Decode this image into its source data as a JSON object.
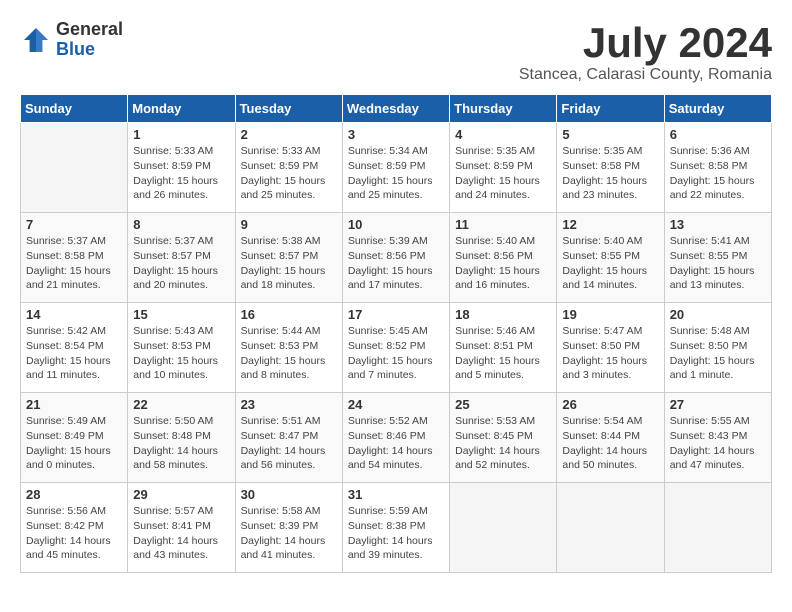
{
  "logo": {
    "general": "General",
    "blue": "Blue"
  },
  "title": {
    "month_year": "July 2024",
    "location": "Stancea, Calarasi County, Romania"
  },
  "weekdays": [
    "Sunday",
    "Monday",
    "Tuesday",
    "Wednesday",
    "Thursday",
    "Friday",
    "Saturday"
  ],
  "weeks": [
    [
      {
        "day": "",
        "info": ""
      },
      {
        "day": "1",
        "info": "Sunrise: 5:33 AM\nSunset: 8:59 PM\nDaylight: 15 hours\nand 26 minutes."
      },
      {
        "day": "2",
        "info": "Sunrise: 5:33 AM\nSunset: 8:59 PM\nDaylight: 15 hours\nand 25 minutes."
      },
      {
        "day": "3",
        "info": "Sunrise: 5:34 AM\nSunset: 8:59 PM\nDaylight: 15 hours\nand 25 minutes."
      },
      {
        "day": "4",
        "info": "Sunrise: 5:35 AM\nSunset: 8:59 PM\nDaylight: 15 hours\nand 24 minutes."
      },
      {
        "day": "5",
        "info": "Sunrise: 5:35 AM\nSunset: 8:58 PM\nDaylight: 15 hours\nand 23 minutes."
      },
      {
        "day": "6",
        "info": "Sunrise: 5:36 AM\nSunset: 8:58 PM\nDaylight: 15 hours\nand 22 minutes."
      }
    ],
    [
      {
        "day": "7",
        "info": "Sunrise: 5:37 AM\nSunset: 8:58 PM\nDaylight: 15 hours\nand 21 minutes."
      },
      {
        "day": "8",
        "info": "Sunrise: 5:37 AM\nSunset: 8:57 PM\nDaylight: 15 hours\nand 20 minutes."
      },
      {
        "day": "9",
        "info": "Sunrise: 5:38 AM\nSunset: 8:57 PM\nDaylight: 15 hours\nand 18 minutes."
      },
      {
        "day": "10",
        "info": "Sunrise: 5:39 AM\nSunset: 8:56 PM\nDaylight: 15 hours\nand 17 minutes."
      },
      {
        "day": "11",
        "info": "Sunrise: 5:40 AM\nSunset: 8:56 PM\nDaylight: 15 hours\nand 16 minutes."
      },
      {
        "day": "12",
        "info": "Sunrise: 5:40 AM\nSunset: 8:55 PM\nDaylight: 15 hours\nand 14 minutes."
      },
      {
        "day": "13",
        "info": "Sunrise: 5:41 AM\nSunset: 8:55 PM\nDaylight: 15 hours\nand 13 minutes."
      }
    ],
    [
      {
        "day": "14",
        "info": "Sunrise: 5:42 AM\nSunset: 8:54 PM\nDaylight: 15 hours\nand 11 minutes."
      },
      {
        "day": "15",
        "info": "Sunrise: 5:43 AM\nSunset: 8:53 PM\nDaylight: 15 hours\nand 10 minutes."
      },
      {
        "day": "16",
        "info": "Sunrise: 5:44 AM\nSunset: 8:53 PM\nDaylight: 15 hours\nand 8 minutes."
      },
      {
        "day": "17",
        "info": "Sunrise: 5:45 AM\nSunset: 8:52 PM\nDaylight: 15 hours\nand 7 minutes."
      },
      {
        "day": "18",
        "info": "Sunrise: 5:46 AM\nSunset: 8:51 PM\nDaylight: 15 hours\nand 5 minutes."
      },
      {
        "day": "19",
        "info": "Sunrise: 5:47 AM\nSunset: 8:50 PM\nDaylight: 15 hours\nand 3 minutes."
      },
      {
        "day": "20",
        "info": "Sunrise: 5:48 AM\nSunset: 8:50 PM\nDaylight: 15 hours\nand 1 minute."
      }
    ],
    [
      {
        "day": "21",
        "info": "Sunrise: 5:49 AM\nSunset: 8:49 PM\nDaylight: 15 hours\nand 0 minutes."
      },
      {
        "day": "22",
        "info": "Sunrise: 5:50 AM\nSunset: 8:48 PM\nDaylight: 14 hours\nand 58 minutes."
      },
      {
        "day": "23",
        "info": "Sunrise: 5:51 AM\nSunset: 8:47 PM\nDaylight: 14 hours\nand 56 minutes."
      },
      {
        "day": "24",
        "info": "Sunrise: 5:52 AM\nSunset: 8:46 PM\nDaylight: 14 hours\nand 54 minutes."
      },
      {
        "day": "25",
        "info": "Sunrise: 5:53 AM\nSunset: 8:45 PM\nDaylight: 14 hours\nand 52 minutes."
      },
      {
        "day": "26",
        "info": "Sunrise: 5:54 AM\nSunset: 8:44 PM\nDaylight: 14 hours\nand 50 minutes."
      },
      {
        "day": "27",
        "info": "Sunrise: 5:55 AM\nSunset: 8:43 PM\nDaylight: 14 hours\nand 47 minutes."
      }
    ],
    [
      {
        "day": "28",
        "info": "Sunrise: 5:56 AM\nSunset: 8:42 PM\nDaylight: 14 hours\nand 45 minutes."
      },
      {
        "day": "29",
        "info": "Sunrise: 5:57 AM\nSunset: 8:41 PM\nDaylight: 14 hours\nand 43 minutes."
      },
      {
        "day": "30",
        "info": "Sunrise: 5:58 AM\nSunset: 8:39 PM\nDaylight: 14 hours\nand 41 minutes."
      },
      {
        "day": "31",
        "info": "Sunrise: 5:59 AM\nSunset: 8:38 PM\nDaylight: 14 hours\nand 39 minutes."
      },
      {
        "day": "",
        "info": ""
      },
      {
        "day": "",
        "info": ""
      },
      {
        "day": "",
        "info": ""
      }
    ]
  ]
}
